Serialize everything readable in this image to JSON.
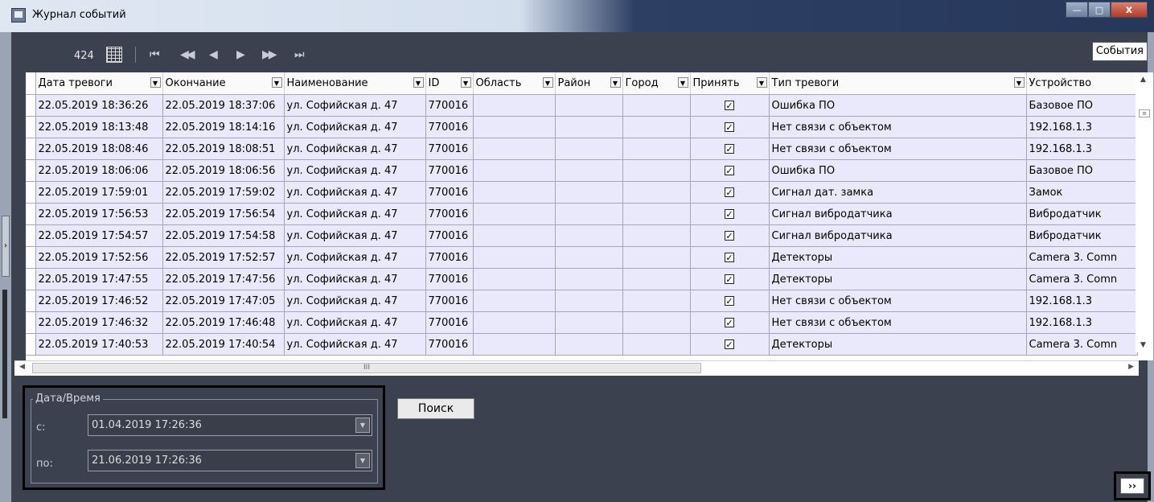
{
  "window": {
    "title": "Журнал событий",
    "minimize": "—",
    "maximize": "□",
    "close": "x"
  },
  "toolbar": {
    "count": "424",
    "nav_first": "⏮",
    "nav_prev_page": "◀◀",
    "nav_prev": "◀",
    "nav_next": "▶",
    "nav_next_page": "▶▶",
    "nav_last": "⏭",
    "events_tab": "События"
  },
  "table": {
    "columns": [
      "Дата тревоги",
      "Окончание",
      "Наименование",
      "ID",
      "Область",
      "Район",
      "Город",
      "Принять",
      "Тип тревоги",
      "Устройство"
    ],
    "rows": [
      [
        "22.05.2019 18:36:26",
        "22.05.2019 18:37:06",
        "ул. Софийская д. 47",
        "770016",
        "",
        "",
        "",
        "☑",
        "Ошибка ПО",
        "Базовое ПО"
      ],
      [
        "22.05.2019 18:13:48",
        "22.05.2019 18:14:16",
        "ул. Софийская д. 47",
        "770016",
        "",
        "",
        "",
        "☑",
        "Нет связи с объектом",
        "192.168.1.3"
      ],
      [
        "22.05.2019 18:08:46",
        "22.05.2019 18:08:51",
        "ул. Софийская д. 47",
        "770016",
        "",
        "",
        "",
        "☑",
        "Нет связи с объектом",
        "192.168.1.3"
      ],
      [
        "22.05.2019 18:06:06",
        "22.05.2019 18:06:56",
        "ул. Софийская д. 47",
        "770016",
        "",
        "",
        "",
        "☑",
        "Ошибка ПО",
        "Базовое ПО"
      ],
      [
        "22.05.2019 17:59:01",
        "22.05.2019 17:59:02",
        "ул. Софийская д. 47",
        "770016",
        "",
        "",
        "",
        "☑",
        "Сигнал дат. замка",
        "Замок"
      ],
      [
        "22.05.2019 17:56:53",
        "22.05.2019 17:56:54",
        "ул. Софийская д. 47",
        "770016",
        "",
        "",
        "",
        "☑",
        "Сигнал вибродатчика",
        "Вибродатчик"
      ],
      [
        "22.05.2019 17:54:57",
        "22.05.2019 17:54:58",
        "ул. Софийская д. 47",
        "770016",
        "",
        "",
        "",
        "☑",
        "Сигнал вибродатчика",
        "Вибродатчик"
      ],
      [
        "22.05.2019 17:52:56",
        "22.05.2019 17:52:57",
        "ул. Софийская д. 47",
        "770016",
        "",
        "",
        "",
        "☑",
        "Детекторы",
        "Camera 3. Comn"
      ],
      [
        "22.05.2019 17:47:55",
        "22.05.2019 17:47:56",
        "ул. Софийская д. 47",
        "770016",
        "",
        "",
        "",
        "☑",
        "Детекторы",
        "Camera 3. Comn"
      ],
      [
        "22.05.2019 17:46:52",
        "22.05.2019 17:47:05",
        "ул. Софийская д. 47",
        "770016",
        "",
        "",
        "",
        "☑",
        "Нет связи с объектом",
        "192.168.1.3"
      ],
      [
        "22.05.2019 17:46:32",
        "22.05.2019 17:46:48",
        "ул. Софийская д. 47",
        "770016",
        "",
        "",
        "",
        "☑",
        "Нет связи с объектом",
        "192.168.1.3"
      ],
      [
        "22.05.2019 17:40:53",
        "22.05.2019 17:40:54",
        "ул. Софийская д. 47",
        "770016",
        "",
        "",
        "",
        "☑",
        "Детекторы",
        "Camera 3. Comn"
      ]
    ],
    "hscroll_grip": "III",
    "vscroll_grip": "≡"
  },
  "filter": {
    "legend": "Дата/Время",
    "from_label": "с:",
    "from_value": "01.04.2019 17:26:36",
    "to_label": "по:",
    "to_value": "21.06.2019 17:26:36"
  },
  "search_button": "Поиск",
  "more_button": "››",
  "side_handle": "›"
}
